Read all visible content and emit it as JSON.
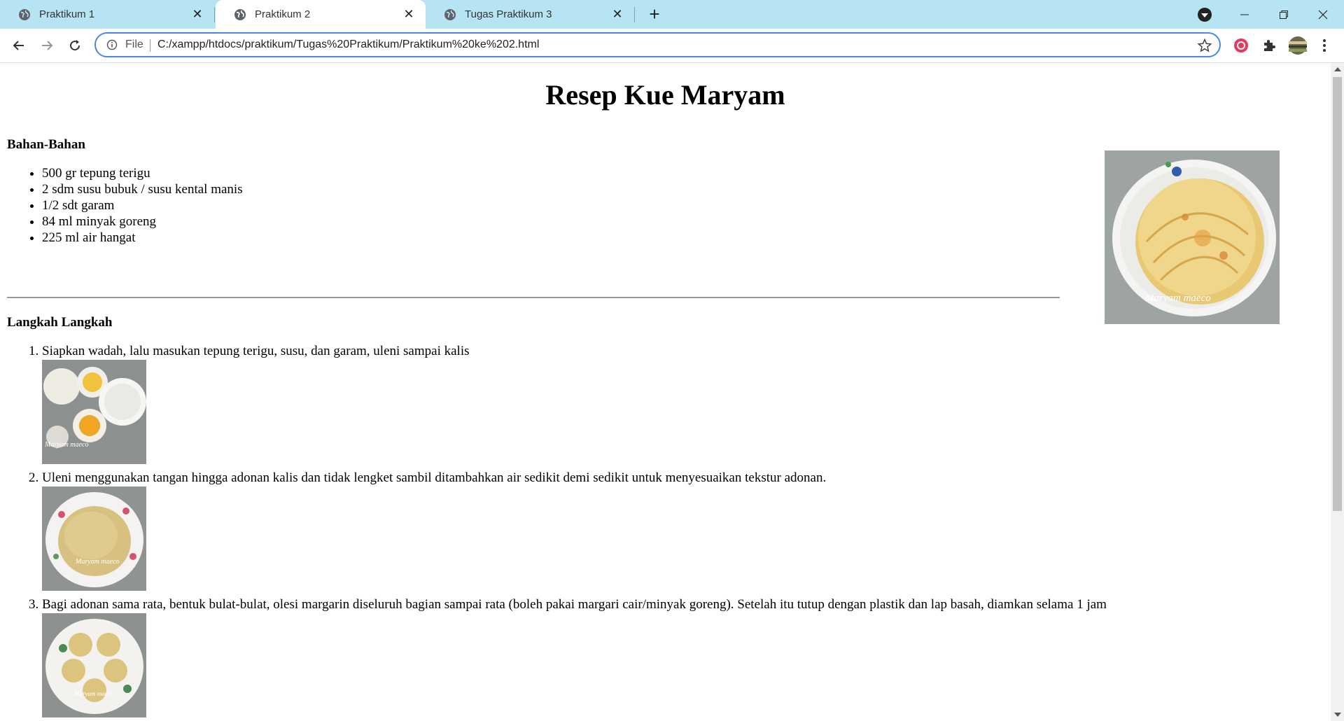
{
  "browser": {
    "tabs": [
      {
        "title": "Praktikum 1",
        "active": false
      },
      {
        "title": "Praktikum 2",
        "active": true
      },
      {
        "title": "Tugas Praktikum 3",
        "active": false
      }
    ],
    "address": {
      "scheme_label": "File",
      "url": "C:/xampp/htdocs/praktikum/Tugas%20Praktikum/Praktikum%20ke%202.html"
    },
    "colors": {
      "tabbar": "#b6e4f2",
      "focus_ring": "#4a86e8"
    }
  },
  "page": {
    "title": "Resep Kue Maryam",
    "ingredients_heading": "Bahan-Bahan",
    "ingredients": [
      "500 gr tepung terigu",
      "2 sdm susu bubuk / susu kental manis",
      "1/2 sdt garam",
      "84 ml minyak goreng",
      "225 ml air hangat"
    ],
    "steps_heading": "Langkah Langkah",
    "steps": [
      {
        "text": "Siapkan wadah, lalu masukan tepung terigu, susu, dan garam, uleni sampai kalis",
        "watermark": "Maryam maeco"
      },
      {
        "text": "Uleni menggunakan tangan hingga adonan kalis dan tidak lengket sambil ditambahkan air sedikit demi sedikit untuk menyesuaikan tekstur adonan.",
        "watermark": "Maryam maeco"
      },
      {
        "text": "Bagi adonan sama rata, bentuk bulat-bulat, olesi margarin diseluruh bagian sampai rata (boleh pakai margari cair/minyak goreng). Setelah itu tutup dengan plastik dan lap basah, diamkan selama 1 jam",
        "watermark": "Maryam maeco"
      }
    ],
    "hero_watermark": "Maryam maeco"
  }
}
